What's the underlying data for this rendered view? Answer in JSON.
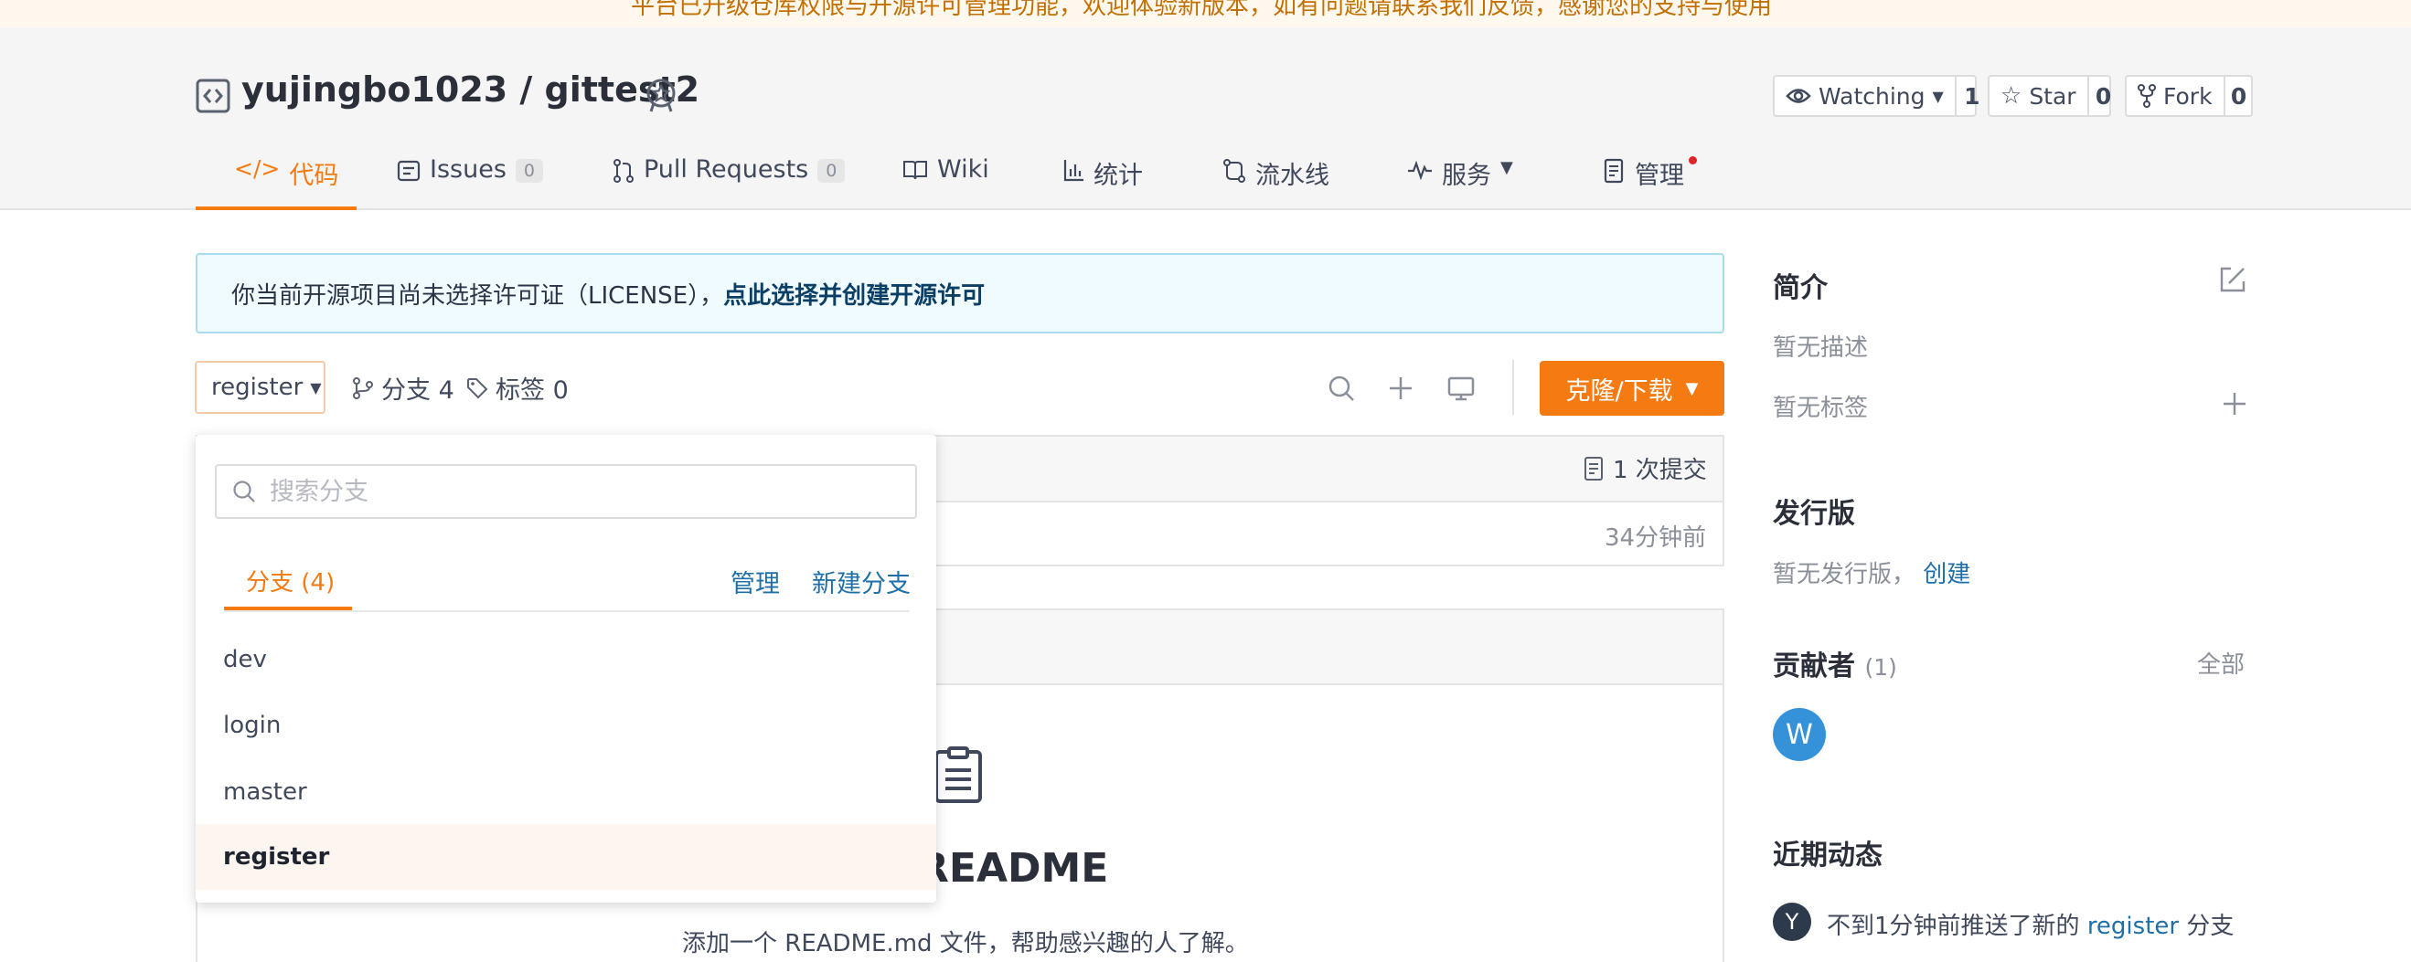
{
  "notice_banner": "平台已升级仓库权限与开源许可管理功能，欢迎体验新版本，如有问题请联系我们反馈，感谢您的支持与使用",
  "repo": {
    "title": "yujingbo1023 / gittest2",
    "watch": {
      "label": "Watching",
      "count": "1"
    },
    "star": {
      "label": "Star",
      "count": "0"
    },
    "fork": {
      "label": "Fork",
      "count": "0"
    }
  },
  "tabs": [
    {
      "label": "代码"
    },
    {
      "label": "Issues",
      "count": "0"
    },
    {
      "label": "Pull Requests",
      "count": "0"
    },
    {
      "label": "Wiki"
    },
    {
      "label": "统计"
    },
    {
      "label": "流水线"
    },
    {
      "label": "服务"
    },
    {
      "label": "管理"
    }
  ],
  "license_notice": {
    "text": "你当前开源项目尚未选择许可证（LICENSE），",
    "link": "点此选择并创建开源许可"
  },
  "toolbar": {
    "branch": "register",
    "branches": "分支 4",
    "tags": "标签 0",
    "clone": "克隆/下载"
  },
  "commit_bar": {
    "commits": "1 次提交",
    "time": "34分钟前"
  },
  "readme": {
    "title": "README",
    "desc": "添加一个 README.md 文件，帮助感兴趣的人了解。"
  },
  "dropdown": {
    "search_placeholder": "搜索分支",
    "tab": "分支 (4)",
    "manage": "管理",
    "new_branch": "新建分支",
    "branches": [
      "dev",
      "login",
      "master",
      "register"
    ],
    "selected": "register"
  },
  "sidebar": {
    "intro_title": "简介",
    "no_desc": "暂无描述",
    "no_tags": "暂无标签",
    "release_title": "发行版",
    "no_release": "暂无发行版，",
    "create": "创建",
    "contrib_title": "贡献者",
    "contrib_count": "(1)",
    "all": "全部",
    "contrib_avatar": "W",
    "activity_title": "近期动态",
    "activity_avatar": "Y",
    "activity_pre": "不到1分钟前推送了新的",
    "activity_branch": "register",
    "activity_post": "分支"
  },
  "colors": {
    "accent": "#f57a12",
    "link": "#1f6fa8",
    "avatar": "#3592d8"
  }
}
